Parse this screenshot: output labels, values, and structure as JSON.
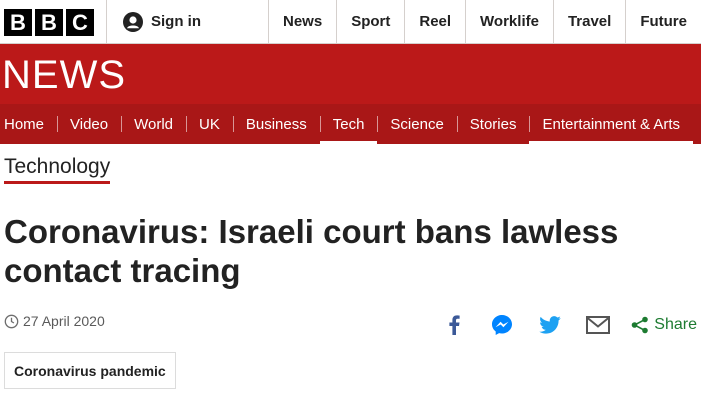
{
  "brand": {
    "logo_letters": [
      "B",
      "B",
      "C"
    ]
  },
  "header": {
    "signin_label": "Sign in",
    "top_nav": [
      "News",
      "Sport",
      "Reel",
      "Worklife",
      "Travel",
      "Future"
    ]
  },
  "news_band": {
    "title": "NEWS",
    "sections": [
      "Home",
      "Video",
      "World",
      "UK",
      "Business",
      "Tech",
      "Science",
      "Stories",
      "Entertainment & Arts"
    ],
    "active_section": "Tech"
  },
  "article": {
    "section_title": "Technology",
    "headline": "Coronavirus: Israeli court bans lawless contact tracing",
    "date": "27 April 2020",
    "share_label": "Share",
    "share_icons": [
      "facebook-icon",
      "messenger-icon",
      "twitter-icon",
      "email-icon",
      "share-icon"
    ],
    "tag": "Coronavirus pandemic"
  },
  "colors": {
    "bbc_red": "#bb1919",
    "nav_red": "#a91717",
    "share_green": "#1d7b31",
    "facebook_blue": "#3b5998",
    "messenger_blue": "#0084ff",
    "twitter_blue": "#1da1f2"
  }
}
